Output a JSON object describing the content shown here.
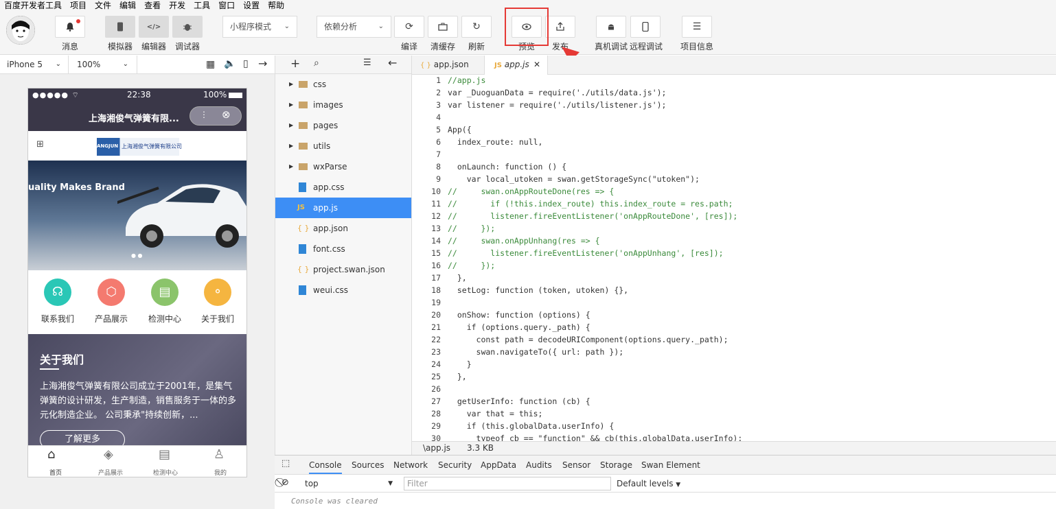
{
  "menu": [
    "百度开发者工具",
    "项目",
    "文件",
    "编辑",
    "查看",
    "开发",
    "工具",
    "窗口",
    "设置",
    "帮助"
  ],
  "toolbar": {
    "msg": "消息",
    "sim": "模拟器",
    "edit": "编辑器",
    "debug": "调试器",
    "mode": "小程序模式",
    "dep": "依赖分析",
    "compile": "编译",
    "clear": "清缓存",
    "refresh": "刷新",
    "preview": "预览",
    "publish": "发布",
    "realdbg": "真机调试",
    "remotedbg": "远程调试",
    "projinfo": "项目信息"
  },
  "device": {
    "name": "iPhone 5",
    "zoom": "100%"
  },
  "phone": {
    "time": "22:38",
    "battery": "100%",
    "title": "上海湘俊气弹簧有限...",
    "banner": "uality Makes Brand",
    "logo_text": "上海湘俊气弹簧有限公司",
    "logo_brand": "ANGJUN",
    "nav": [
      "联系我们",
      "产品展示",
      "检测中心",
      "关于我们"
    ],
    "about_title": "关于我们",
    "about_text": "上海湘俊气弹簧有限公司成立于2001年，是集气弹簧的设计研发，生产制造，销售服务于一体的多元化制造企业。 公司秉承\"持续创新，...",
    "more": "了解更多",
    "tabs": [
      "首页",
      "产品展示",
      "检测中心",
      "我的"
    ]
  },
  "files": [
    "css",
    "images",
    "pages",
    "utils",
    "wxParse",
    "app.css",
    "app.js",
    "app.json",
    "font.css",
    "project.swan.json",
    "weui.css"
  ],
  "editor": {
    "tabs": [
      "app.json",
      "app.js"
    ],
    "file": "\\app.js",
    "size": "3.3 KB",
    "lines": [
      "//app.js",
      "var _DuoguanData = require('./utils/data.js');",
      "var listener = require('./utils/listener.js');",
      "",
      "App({",
      "  index_route: null,",
      "",
      "  onLaunch: function () {",
      "    var local_utoken = swan.getStorageSync(\"utoken\");",
      "//     swan.onAppRouteDone(res => {",
      "//       if (!this.index_route) this.index_route = res.path;",
      "//       listener.fireEventListener('onAppRouteDone', [res]);",
      "//     });",
      "//     swan.onAppUnhang(res => {",
      "//       listener.fireEventListener('onAppUnhang', [res]);",
      "//     });",
      "  },",
      "  setLog: function (token, utoken) {},",
      "",
      "  onShow: function (options) {",
      "    if (options.query._path) {",
      "      const path = decodeURIComponent(options.query._path);",
      "      swan.navigateTo({ url: path });",
      "    }",
      "  },",
      "",
      "  getUserInfo: function (cb) {",
      "    var that = this;",
      "    if (this.globalData.userInfo) {",
      "      typeof cb == \"function\" && cb(this.globalData.userInfo);"
    ]
  },
  "console": {
    "tabs": [
      "Console",
      "Sources",
      "Network",
      "Security",
      "AppData",
      "Audits",
      "Sensor",
      "Storage",
      "Swan Element"
    ],
    "context": "top",
    "filter": "Filter",
    "levels": "Default levels",
    "message": "Console was cleared"
  }
}
